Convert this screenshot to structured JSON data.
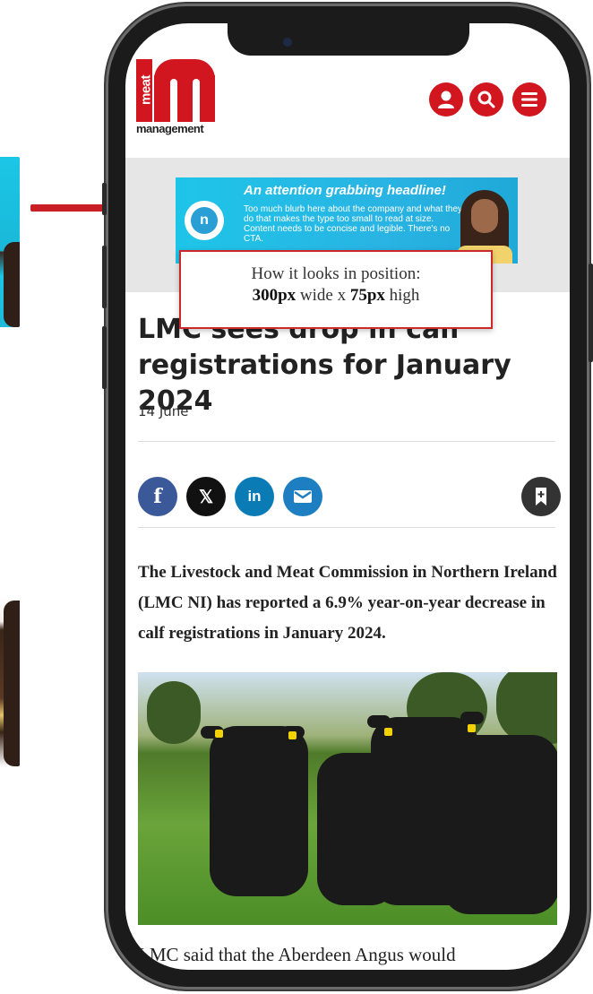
{
  "site": {
    "logo_vertical": "meat",
    "logo_sub": "management"
  },
  "header": {
    "icons": [
      "account-icon",
      "search-icon",
      "menu-icon"
    ]
  },
  "ad": {
    "headline": "An attention grabbing headline!",
    "blurb": "Too much blurb here about the company and what they do that makes the type too small to read at size. Content needs to be concise and legible. There's no CTA."
  },
  "callout": {
    "line1": "How it looks in position:",
    "width_value": "300px",
    "width_word": " wide x ",
    "height_value": "75px",
    "height_word": " high"
  },
  "article": {
    "title": "LMC sees drop in calf registrations for January 2024",
    "date": "14 June",
    "lead": "The Livestock and Meat Commission in Northern Ireland (LMC NI) has reported a 6.9% year-on-year decrease in calf registrations in January 2024.",
    "body_start": "LMC said that the Aberdeen Angus would"
  },
  "share": {
    "facebook": "f",
    "x": "𝕏",
    "linkedin": "in"
  },
  "colors": {
    "brand_red": "#d1161f",
    "arrow_red": "#c81e25",
    "facebook": "#3b5998",
    "linkedin": "#0a7bb5",
    "email": "#1d7fc1"
  }
}
